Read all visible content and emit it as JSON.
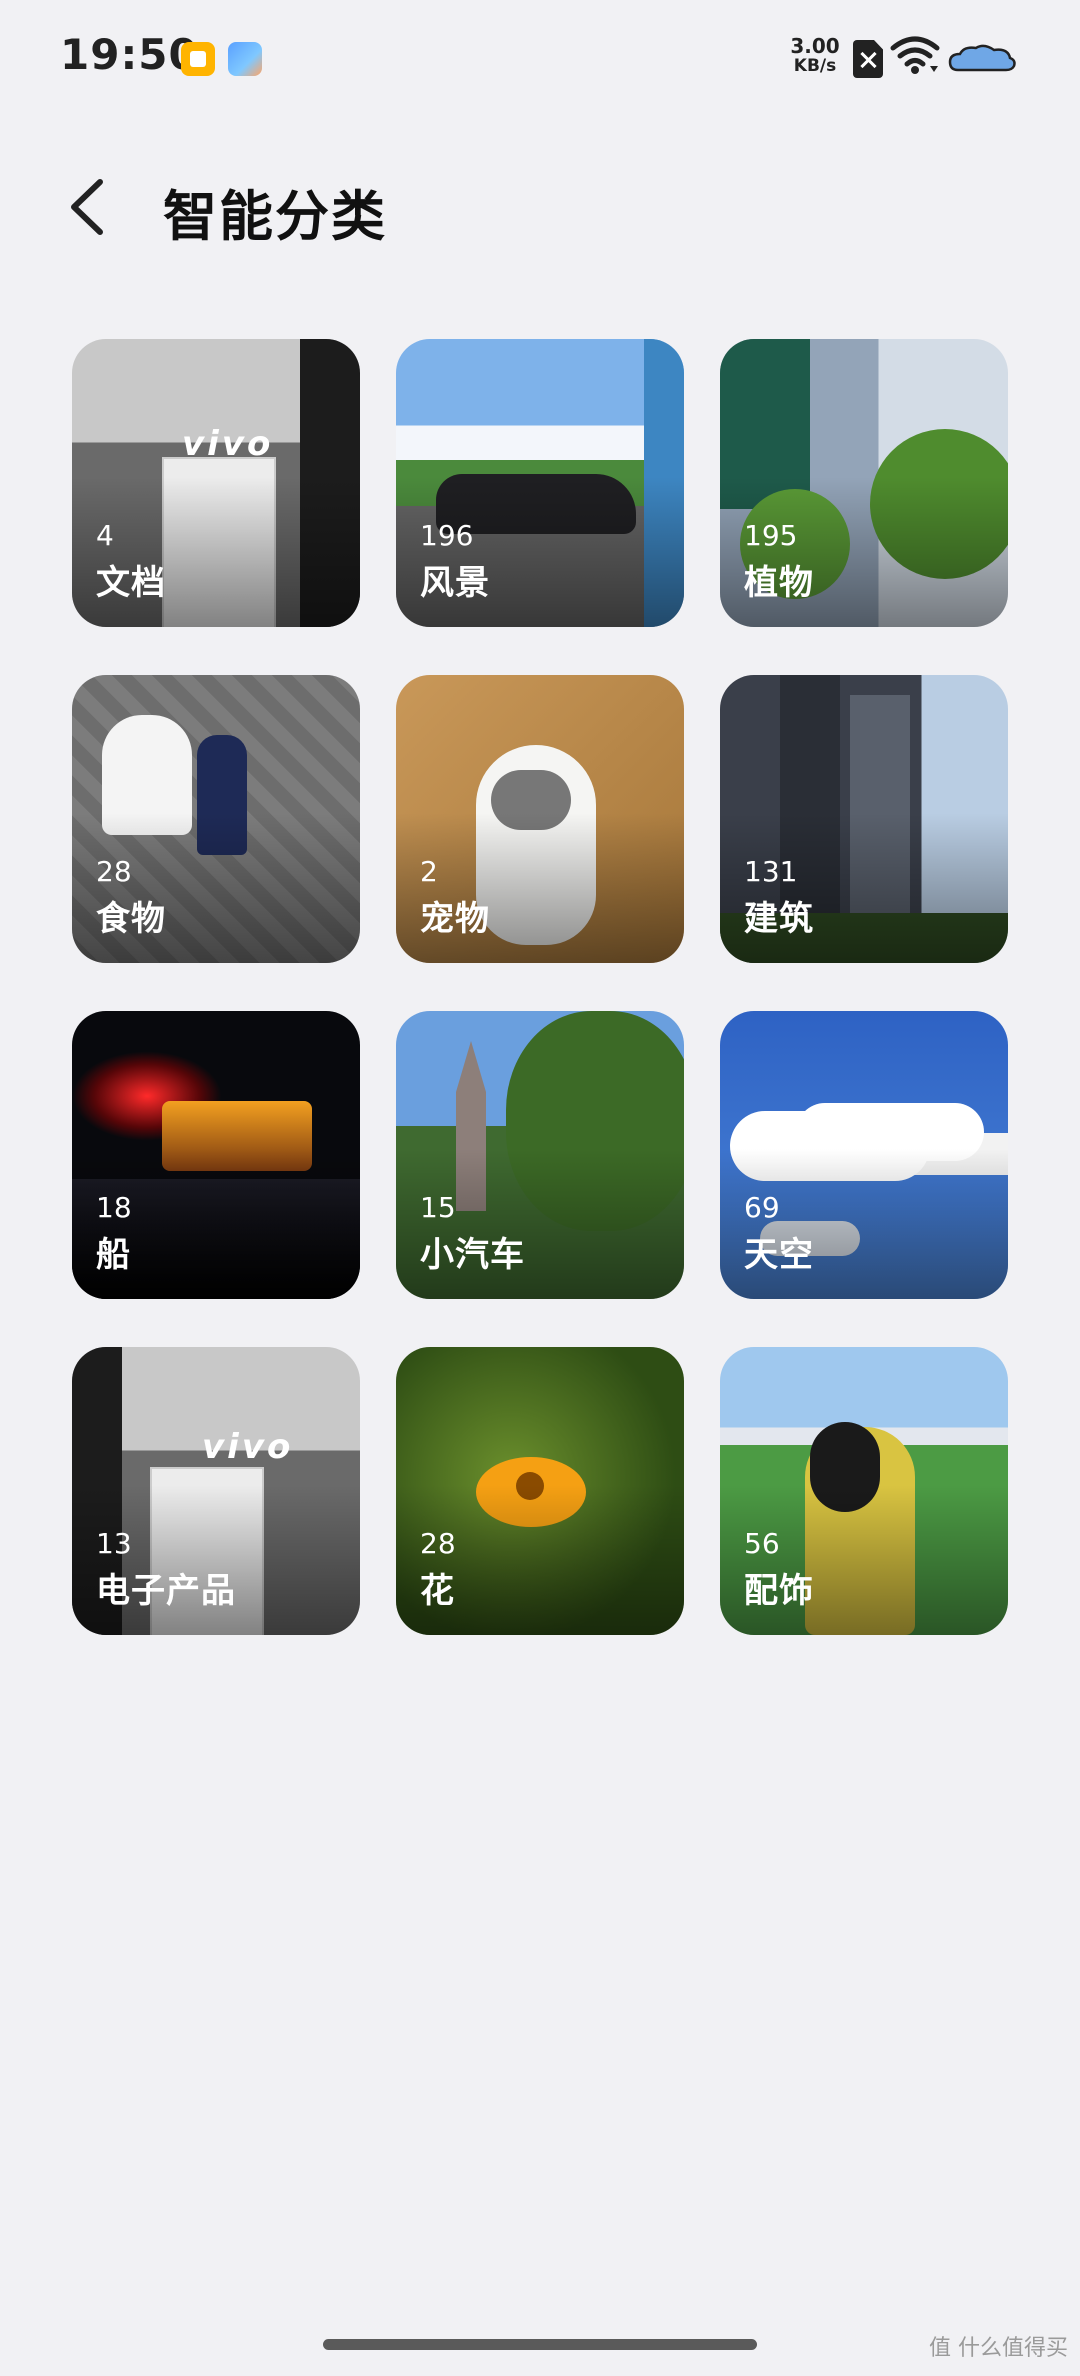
{
  "status_bar": {
    "time": "19:50",
    "network_speed_value": "3.00",
    "network_speed_unit": "KB/s",
    "icons": [
      "app-notification-icon",
      "app-gallery-icon",
      "no-sim-icon",
      "wifi-icon",
      "battery-icon"
    ]
  },
  "header": {
    "back_icon": "chevron-left-icon",
    "title": "智能分类"
  },
  "categories": [
    {
      "count": "4",
      "label": "文档"
    },
    {
      "count": "196",
      "label": "风景"
    },
    {
      "count": "195",
      "label": "植物"
    },
    {
      "count": "28",
      "label": "食物"
    },
    {
      "count": "2",
      "label": "宠物"
    },
    {
      "count": "131",
      "label": "建筑"
    },
    {
      "count": "18",
      "label": "船"
    },
    {
      "count": "15",
      "label": "小汽车"
    },
    {
      "count": "69",
      "label": "天空"
    },
    {
      "count": "13",
      "label": "电子产品"
    },
    {
      "count": "28",
      "label": "花"
    },
    {
      "count": "56",
      "label": "配饰"
    }
  ],
  "photo_text": {
    "vivo_logo": "vivo"
  },
  "watermark": "值 什么值得买"
}
